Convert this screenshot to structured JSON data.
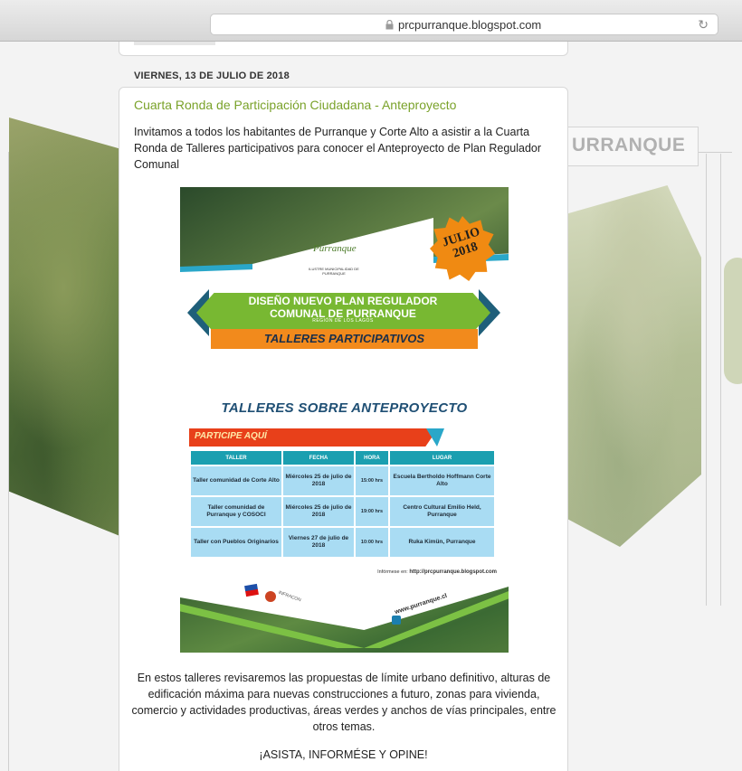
{
  "browser": {
    "url": "prcpurranque.blogspot.com"
  },
  "background": {
    "label": "URRANQUE"
  },
  "post": {
    "date": "VIERNES, 13 DE JULIO DE 2018",
    "title": "Cuarta Ronda de Participación Ciudadana - Anteproyecto",
    "intro": "Invitamos a todos los habitantes de Purranque y Corte Alto a asistir a la Cuarta Ronda de Talleres participativos para conocer el Anteproyecto de Plan Regulador Comunal",
    "body": "En estos talleres revisaremos las propuestas de límite urbano definitivo, alturas de edificación máxima para nuevas construcciones a futuro, zonas para vivienda, comercio y actividades productivas, áreas verdes y anchos de vías principales, entre otros temas.",
    "cta": "¡ASISTA, INFORMÉSE Y OPINE!"
  },
  "poster": {
    "logo": "Purranque",
    "logo_sub": "ILUSTRE MUNICIPALIDAD DE PURRANQUE",
    "badge_month": "JULIO",
    "badge_year": "2018",
    "banner_line1": "DISEÑO NUEVO PLAN REGULADOR",
    "banner_line2": "COMUNAL DE PURRANQUE",
    "banner_region": "REGIÓN DE LOS LAGOS",
    "banner_talleres": "TALLERES PARTICIPATIVOS",
    "heading": "TALLERES SOBRE ANTEPROYECTO",
    "participe": "PARTICIPE AQUÍ",
    "table": {
      "headers": [
        "TALLER",
        "FECHA",
        "HORA",
        "LUGAR"
      ],
      "rows": [
        [
          "Taller comunidad de Corte Alto",
          "Miércoles 25 de julio de 2018",
          "15:00 hrs",
          "Escuela Bertholdo Hoffmann Corte Alto"
        ],
        [
          "Taller comunidad de Purranque y COSOCI",
          "Miércoles 25 de julio de 2018",
          "19:00 hrs",
          "Centro Cultural Emilio Held, Purranque"
        ],
        [
          "Taller con Pueblos Originarios",
          "Viernes 27 de julio de 2018",
          "10:00 hrs",
          "Ruka Kimün, Purranque"
        ]
      ]
    },
    "info_prefix": "Infórmese en:",
    "info_url": "http://prcpurranque.blogspot.com",
    "sponsor": "INFRACON",
    "website": "www.purranque.cl"
  }
}
